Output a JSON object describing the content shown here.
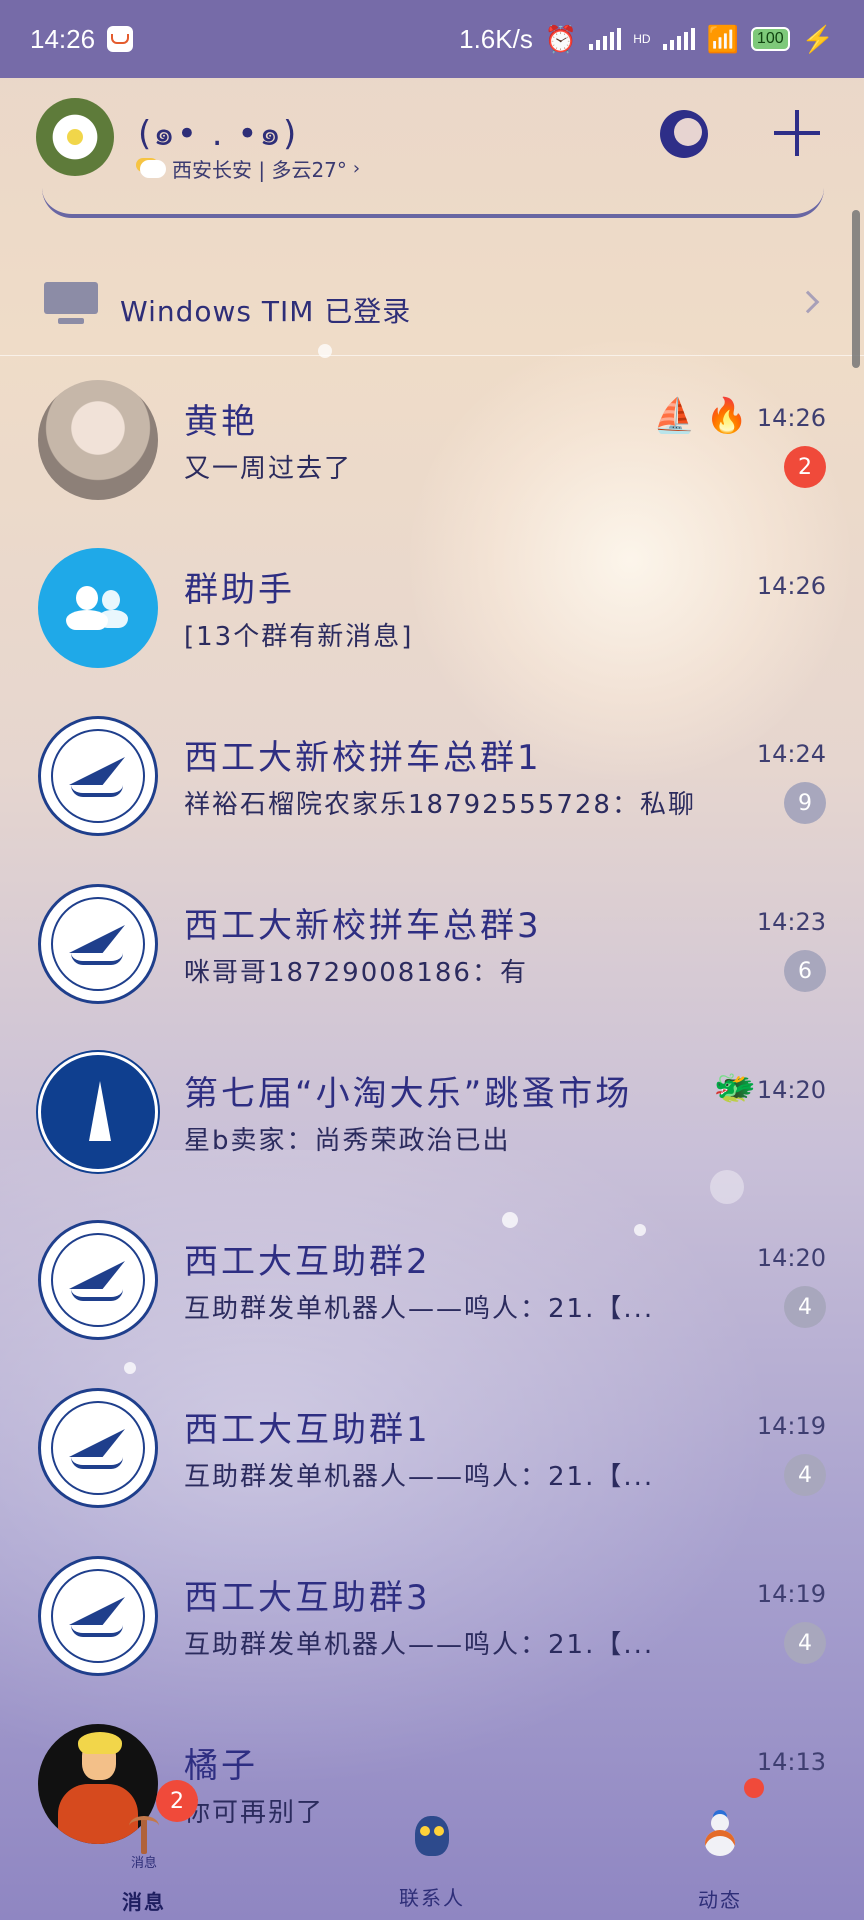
{
  "status_bar": {
    "time": "14:26",
    "network_speed": "1.6K/s",
    "hd_label": "HD",
    "battery": "100"
  },
  "header": {
    "nickname": "(๑• . •๑)",
    "weather": "西安长安 | 多云27°",
    "avatar_icon": "daisy-avatar",
    "theme_icon": "moon-icon",
    "add_icon": "plus-icon"
  },
  "device_login": {
    "text": "Windows TIM 已登录",
    "icon": "monitor-icon"
  },
  "conversations": [
    {
      "name": "黄艳",
      "preview": "又一周过去了",
      "time": "14:26",
      "badge": "2",
      "badge_color": "#f04a3a",
      "tags": [
        "⛵",
        "🔥"
      ]
    },
    {
      "name": "群助手",
      "preview": "[13个群有新消息]",
      "time": "14:26",
      "badge": "",
      "tags": []
    },
    {
      "name": "西工大新校拼车总群1",
      "preview": "祥裕石榴院农家乐18792555728：私聊",
      "time": "14:24",
      "badge": "9",
      "badge_color": "#a8a7bd",
      "tags": []
    },
    {
      "name": "西工大新校拼车总群3",
      "preview": "咪哥哥18729008186：有",
      "time": "14:23",
      "badge": "6",
      "badge_color": "#a8a7bd",
      "tags": []
    },
    {
      "name": "第七届“小淘大乐”跳蚤市场",
      "preview": "星b卖家：尚秀荣政治已出",
      "time": "14:20",
      "badge": "",
      "tags": [
        "🐲"
      ]
    },
    {
      "name": "西工大互助群2",
      "preview": "互助群发单机器人——鸣人：21.【...",
      "time": "14:20",
      "badge": "4",
      "badge_color": "#a8a7bd",
      "tags": []
    },
    {
      "name": "西工大互助群1",
      "preview": "互助群发单机器人——鸣人：21.【...",
      "time": "14:19",
      "badge": "4",
      "badge_color": "#a8a7bd",
      "tags": []
    },
    {
      "name": "西工大互助群3",
      "preview": "互助群发单机器人——鸣人：21.【...",
      "time": "14:19",
      "badge": "4",
      "badge_color": "#a8a7bd",
      "tags": []
    },
    {
      "name": "橘子",
      "preview": "你可再别了",
      "time": "14:13",
      "badge": "",
      "tags": []
    }
  ],
  "bottom_nav": {
    "messages": {
      "label": "消息",
      "sub_label": "消息",
      "badge": "2"
    },
    "contacts": {
      "label": "联系人"
    },
    "feed": {
      "label": "动态"
    }
  },
  "colors": {
    "status_bar": "#766ba8",
    "unread_badge": "#f04a3a",
    "muted_badge": "#a8a7bd",
    "group_helper": "#1fa9e8"
  }
}
